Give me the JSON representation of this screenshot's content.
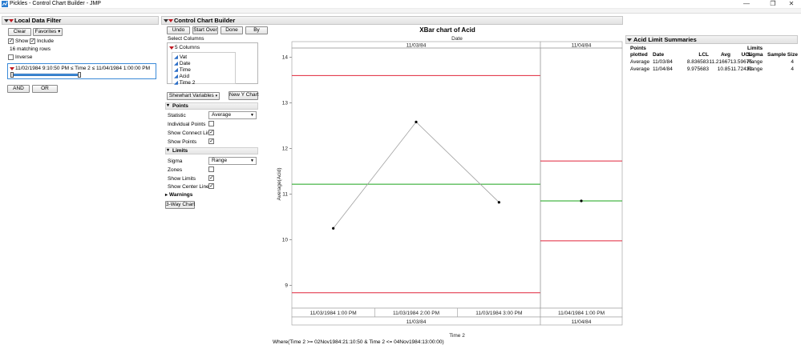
{
  "window": {
    "title": "Pickles - Control Chart Builder - JMP",
    "minimize": "—",
    "restore": "❐",
    "close": "✕"
  },
  "local_filter": {
    "header": "Local Data Filter",
    "clear_label": "Clear",
    "favorites_label": "Favorites ▾",
    "show_label": "Show",
    "include_label": "Include",
    "show_checked": true,
    "include_checked": true,
    "matching_rows": "16 matching rows",
    "inverse_label": "Inverse",
    "inverse_checked": false,
    "range_text": "11/02/1984 9:10:50 PM ≤  Time 2  ≤ 11/04/1984 1:00:00 PM",
    "and_label": "AND",
    "or_label": "OR"
  },
  "builder": {
    "header": "Control Chart Builder",
    "undo_label": "Undo",
    "start_over_label": "Start Over",
    "done_label": "Done",
    "by_label": "By",
    "select_columns_label": "Select Columns",
    "columns_count": "5 Columns",
    "columns": [
      "Vat",
      "Date",
      "Time",
      "Acid",
      "Time 2"
    ],
    "shewhart_label": "Shewhart Variables",
    "new_y_chart_label": "New Y Chart",
    "points": {
      "header": "Points",
      "statistic_label": "Statistic",
      "statistic_value": "Average",
      "individual_points_label": "Individual Points",
      "individual_points_checked": false,
      "show_connect_line_label": "Show Connect Line",
      "show_connect_line_checked": true,
      "show_points_label": "Show Points",
      "show_points_checked": true
    },
    "limits": {
      "header": "Limits",
      "sigma_label": "Sigma",
      "sigma_value": "Range",
      "zones_label": "Zones",
      "zones_checked": false,
      "show_limits_label": "Show Limits",
      "show_limits_checked": true,
      "show_center_line_label": "Show Center Line",
      "show_center_line_checked": true
    },
    "warnings_label": "Warnings",
    "three_way_label": "3-Way Chart"
  },
  "chart_data": {
    "type": "line",
    "title": "XBar chart of Acid",
    "top_axis_label": "Date",
    "xlabel": "Time 2",
    "ylabel": "Average(Acid)",
    "ylim": [
      8.5,
      14.2
    ],
    "yticks": [
      9,
      10,
      11,
      12,
      13,
      14
    ],
    "grid": false,
    "where_clause": "Where(Time 2 >= 02Nov1984:21:10:50 & Time 2 <= 04Nov1984:13:00:00)",
    "colors": {
      "limit": "#e0243a",
      "center": "#1aa51a",
      "line": "#a0a0a0",
      "point": "#000000"
    },
    "phases": [
      {
        "label": "11/03/84",
        "x": [
          "11/03/1984 1:00 PM",
          "11/03/1984 2:00 PM",
          "11/03/1984 3:00 PM"
        ],
        "values": [
          10.25,
          12.58,
          10.82
        ],
        "lcl": 8.836583,
        "avg": 11.21667,
        "ucl": 13.59675
      },
      {
        "label": "11/04/84",
        "x": [
          "11/04/1984 1:00 PM"
        ],
        "values": [
          10.85
        ],
        "lcl": 9.975683,
        "avg": 10.85,
        "ucl": 11.72432
      }
    ]
  },
  "summary": {
    "header": "Acid Limit Summaries",
    "limits_group": "Limits",
    "points_plotted_top": "Points",
    "points_plotted_bottom": "plotted",
    "columns": [
      "Date",
      "LCL",
      "Avg",
      "UCL",
      "Sigma",
      "Sample Size"
    ],
    "rows": [
      [
        "Average",
        "11/03/84",
        "8.836583",
        "11.21667",
        "13.59675",
        "Range",
        "4"
      ],
      [
        "Average",
        "11/04/84",
        "9.975683",
        "10.85",
        "11.72432",
        "Range",
        "4"
      ]
    ]
  }
}
